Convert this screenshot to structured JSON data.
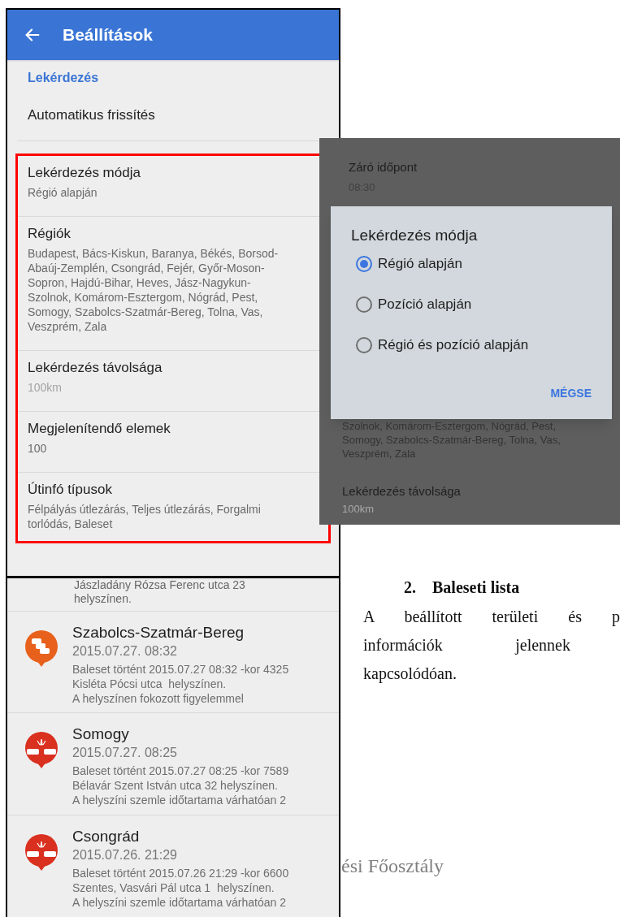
{
  "settings_screen": {
    "title": "Beállítások",
    "section": "Lekérdezés",
    "items": [
      {
        "title": "Automatikus frissítés"
      }
    ],
    "highlighted_items": [
      {
        "title": "Lekérdezés módja",
        "summary_lines": [
          "Régió alapján"
        ],
        "disabled": false
      },
      {
        "title": "Régiók",
        "summary_lines": [
          "Budapest, Bács-Kiskun, Baranya, Békés, Borsod-",
          "Abaúj-Zemplén, Csongrád, Fejér, Győr-Moson-",
          "Sopron, Hajdú-Bihar, Heves, Jász-Nagykun-",
          "Szolnok, Komárom-Esztergom, Nógrád, Pest,",
          "Somogy, Szabolcs-Szatmár-Bereg, Tolna, Vas,",
          "Veszprém, Zala"
        ],
        "disabled": false
      },
      {
        "title": "Lekérdezés távolsága",
        "summary_lines": [
          "100km"
        ],
        "disabled": true
      },
      {
        "title": "Megjelenítendő elemek",
        "summary_lines": [
          "100"
        ],
        "disabled": false
      },
      {
        "title": "Útinfó típusok",
        "summary_lines": [
          "Félpályás útlezárás, Teljes útlezárás, Forgalmi",
          "torlódás, Baleset"
        ],
        "disabled": false
      }
    ]
  },
  "dialog_screen": {
    "background_top": {
      "title": "Záró időpont",
      "summary": "08:30"
    },
    "dialog": {
      "title": "Lekérdezés módja",
      "options": [
        {
          "label": "Régió alapján",
          "selected": true
        },
        {
          "label": "Pozíció alapján",
          "selected": false
        },
        {
          "label": "Régió és pozíció alapján",
          "selected": false
        }
      ],
      "button": "MÉGSE"
    },
    "background_lines": [
      "Szolnok, Komárom-Esztergom, Nógrád, Pest,",
      "Somogy, Szabolcs-Szatmár-Bereg, Tolna, Vas,",
      "Veszprém, Zala"
    ],
    "background_bottom": {
      "title": "Lekérdezés távolsága",
      "summary": "100km",
      "disabled": true
    }
  },
  "list_screen": {
    "partial_lines": [
      "Jászladány Rózsa Ferenc utca 23",
      "helyszínen."
    ],
    "incidents": [
      {
        "kind": "traffic",
        "title": "Szabolcs-Szatmár-Bereg",
        "date": "2015.07.27. 08:32",
        "lines": [
          "Baleset történt 2015.07.27 08:32 -kor 4325",
          "Kisléta Pócsi utca  helyszínen.",
          "A helyszínen fokozott figyelemmel"
        ]
      },
      {
        "kind": "accident",
        "title": "Somogy",
        "date": "2015.07.27. 08:25",
        "lines": [
          "Baleset történt 2015.07.27 08:25 -kor 7589",
          "Bélavár Szent István utca 32 helyszínen.",
          "A helyszíni szemle időtartama várhatóan 2"
        ]
      },
      {
        "kind": "accident",
        "title": "Csongrád",
        "date": "2015.07.26. 21:29",
        "lines": [
          "Baleset történt 2015.07.26 21:29 -kor 6600",
          "Szentes, Vasvári Pál utca 1  helyszínen.",
          "A helyszíni szemle időtartama várhatóan 2"
        ]
      }
    ]
  },
  "document": {
    "heading_number": "2.",
    "heading": "Baleseti lista",
    "paragraph_lines": [
      "A beállított területi és p",
      "információk jelennek",
      "kapcsolódóan."
    ],
    "footer": "ési Főosztály"
  }
}
